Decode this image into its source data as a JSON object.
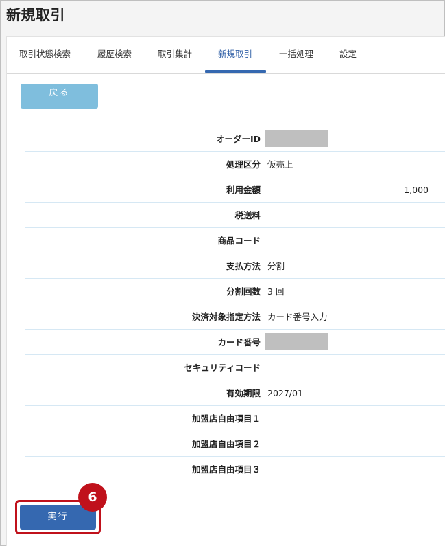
{
  "page": {
    "title": "新規取引"
  },
  "tabs": [
    {
      "label": "取引状態検索",
      "active": false
    },
    {
      "label": "履歴検索",
      "active": false
    },
    {
      "label": "取引集計",
      "active": false
    },
    {
      "label": "新規取引",
      "active": true
    },
    {
      "label": "一括処理",
      "active": false
    },
    {
      "label": "設定",
      "active": false
    }
  ],
  "back_button": {
    "label": "戻る"
  },
  "form": {
    "rows": [
      {
        "label": "オーダーID",
        "value": "",
        "masked": true
      },
      {
        "label": "処理区分",
        "value": "仮売上"
      },
      {
        "label": "利用金額",
        "value": "1,000"
      },
      {
        "label": "税送料",
        "value": ""
      },
      {
        "label": "商品コード",
        "value": ""
      },
      {
        "label": "支払方法",
        "value": "分割"
      },
      {
        "label": "分割回数",
        "value": "3 回"
      },
      {
        "label": "決済対象指定方法",
        "value": "カード番号入力"
      },
      {
        "label": "カード番号",
        "value": "",
        "masked": true
      },
      {
        "label": "セキュリティコード",
        "value": ""
      },
      {
        "label": "有効期限",
        "value": "2027/01"
      },
      {
        "label": "加盟店自由項目１",
        "value": ""
      },
      {
        "label": "加盟店自由項目２",
        "value": ""
      },
      {
        "label": "加盟店自由項目３",
        "value": ""
      }
    ]
  },
  "execute_button": {
    "label": "実行"
  },
  "step_badge": {
    "number": "6"
  },
  "colors": {
    "accent": "#3568b0",
    "back_button": "#7fbedd",
    "highlight": "#c0111b",
    "row_divider": "#d6e8f4"
  }
}
